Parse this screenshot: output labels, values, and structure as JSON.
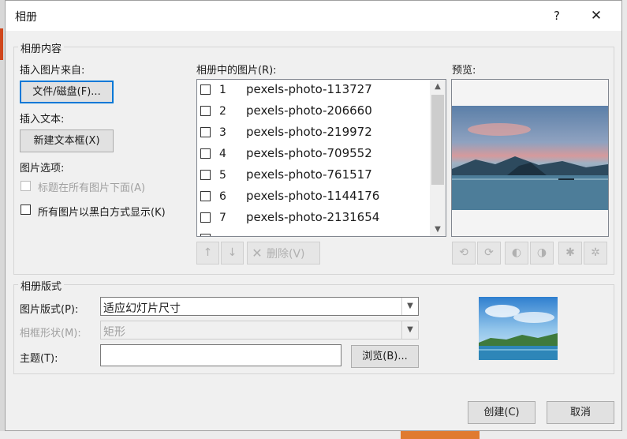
{
  "dialog": {
    "title": "相册",
    "help_label": "?",
    "close_label": "✕"
  },
  "album_content": {
    "group_label": "相册内容",
    "insert_from_label": "插入图片来自:",
    "file_disk_button": "文件/磁盘(F)...",
    "insert_text_label": "插入文本:",
    "new_textbox_button": "新建文本框(X)",
    "picture_options_label": "图片选项:",
    "captions_below_label": "标题在所有图片下面(A)",
    "black_white_label": "所有图片以黑白方式显示(K)"
  },
  "pictures_list": {
    "label": "相册中的图片(R):",
    "items": [
      {
        "num": "1",
        "name": "pexels-photo-113727"
      },
      {
        "num": "2",
        "name": "pexels-photo-206660"
      },
      {
        "num": "3",
        "name": "pexels-photo-219972"
      },
      {
        "num": "4",
        "name": "pexels-photo-709552"
      },
      {
        "num": "5",
        "name": "pexels-photo-761517"
      },
      {
        "num": "6",
        "name": "pexels-photo-1144176"
      },
      {
        "num": "7",
        "name": "pexels-photo-2131654"
      }
    ],
    "move_up_glyph": "↑",
    "move_down_glyph": "↓",
    "delete_label": "删除(V)"
  },
  "preview": {
    "label": "预览:"
  },
  "album_layout": {
    "group_label": "相册版式",
    "picture_layout_label": "图片版式(P):",
    "picture_layout_value": "适应幻灯片尺寸",
    "frame_shape_label": "相框形状(M):",
    "frame_shape_value": "矩形",
    "theme_label": "主题(T):",
    "theme_value": "",
    "browse_button": "浏览(B)..."
  },
  "footer": {
    "create_button": "创建(C)",
    "cancel_button": "取消"
  },
  "colors": {
    "accent": "#0078d7",
    "window_bg": "#f0f0f0"
  }
}
